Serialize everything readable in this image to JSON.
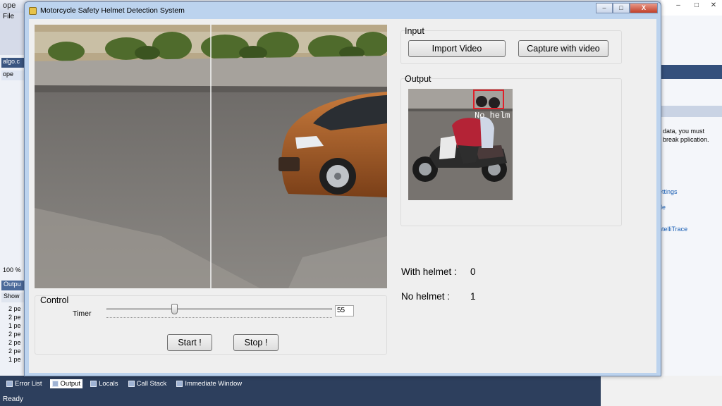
{
  "window": {
    "title": "Motorcycle Safety Helmet Detection System",
    "controls": {
      "minimize": "–",
      "maximize": "□",
      "close": "X"
    }
  },
  "input_group": {
    "label": "Input",
    "import_button": "Import Video",
    "capture_button": "Capture with video"
  },
  "output_group": {
    "label": "Output",
    "detection_label": "No helm"
  },
  "control_group": {
    "label": "Control",
    "timer_label": "Timer",
    "timer_value": "55",
    "timer_level": 0.3,
    "start_button": "Start !",
    "stop_button": "Stop !"
  },
  "stats": {
    "with_helmet_label": "With helmet :",
    "with_helmet_value": "0",
    "no_helmet_label": "No helmet :",
    "no_helmet_value": "1"
  },
  "ide": {
    "title": "ope",
    "menu": "File",
    "tab": "algo.c",
    "tab2": "ope",
    "zoom": "100 %",
    "output_header": "Outpu",
    "output_sub": "Show",
    "output_lines": [
      "2 pe",
      "2 pe",
      "1 pe",
      "2 pe",
      "2 pe",
      "2 pe",
      "1 pe"
    ],
    "right_text": "data, you must break pplication.",
    "right_links": [
      "ettings",
      "de",
      "ntelliTrace"
    ],
    "bottom_tabs": [
      "Error List",
      "Output",
      "Locals",
      "Call Stack",
      "Immediate Window"
    ],
    "status": "Ready"
  },
  "colors": {
    "window_frame": "#bcd3ee",
    "client_bg": "#efefef",
    "detection_box": "#e0202a",
    "ide_dark": "#2d3f5d"
  }
}
